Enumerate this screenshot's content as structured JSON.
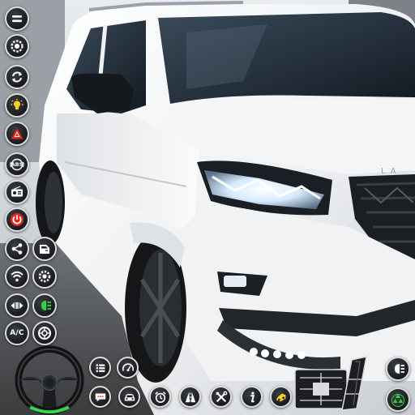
{
  "theme": {
    "button_fill": "#1b1d20",
    "button_ring": "#d8dadc",
    "hazard_red": "#e2231a",
    "power_red": "#e0261d",
    "light_yellow": "#f4d21e",
    "headlight_green": "#35d23f",
    "steering_accent": "#36d64a"
  },
  "hud": {
    "left_column": [
      {
        "id": "menu",
        "icon": "menu-icon"
      },
      {
        "id": "settings",
        "icon": "gear-badge-icon"
      },
      {
        "id": "camera",
        "icon": "refresh-camera-icon"
      },
      {
        "id": "lights",
        "icon": "lightbulb-icon"
      },
      {
        "id": "hazard",
        "icon": "hazard-triangle-icon"
      },
      {
        "id": "abs",
        "icon": "abs-icon",
        "label": "ABS"
      },
      {
        "id": "radio",
        "icon": "radio-icon"
      },
      {
        "id": "power",
        "icon": "power-icon"
      }
    ],
    "grid": [
      {
        "id": "share",
        "icon": "share-icon"
      },
      {
        "id": "door",
        "icon": "car-door-icon"
      },
      {
        "id": "wifi",
        "icon": "wifi-icon"
      },
      {
        "id": "engine",
        "icon": "engine-icon"
      },
      {
        "id": "indicator",
        "icon": "left-right-arrows-icon"
      },
      {
        "id": "headlight",
        "icon": "headlight-icon"
      },
      {
        "id": "ac",
        "icon": "ac-icon",
        "label": "A/C"
      },
      {
        "id": "wheel-config",
        "icon": "tire-icon"
      }
    ],
    "bottom_row": [
      {
        "id": "grid-menu",
        "icon": "grid-menu-icon"
      },
      {
        "id": "speedometer",
        "icon": "speedometer-icon"
      },
      {
        "id": "chat",
        "icon": "chat-icon"
      },
      {
        "id": "car",
        "icon": "car-front-icon"
      },
      {
        "id": "alarm",
        "icon": "alarm-clock-icon"
      },
      {
        "id": "road",
        "icon": "road-icon"
      },
      {
        "id": "tools",
        "icon": "tools-icon"
      },
      {
        "id": "info",
        "icon": "info-icon"
      },
      {
        "id": "tow",
        "icon": "car-tow-icon"
      }
    ],
    "gear_shifter": {
      "icon": "gear-shifter-icon"
    },
    "right_buttons": [
      {
        "id": "high-beam",
        "icon": "high-beam-icon"
      },
      {
        "id": "recycle",
        "icon": "recycle-icon"
      }
    ]
  }
}
